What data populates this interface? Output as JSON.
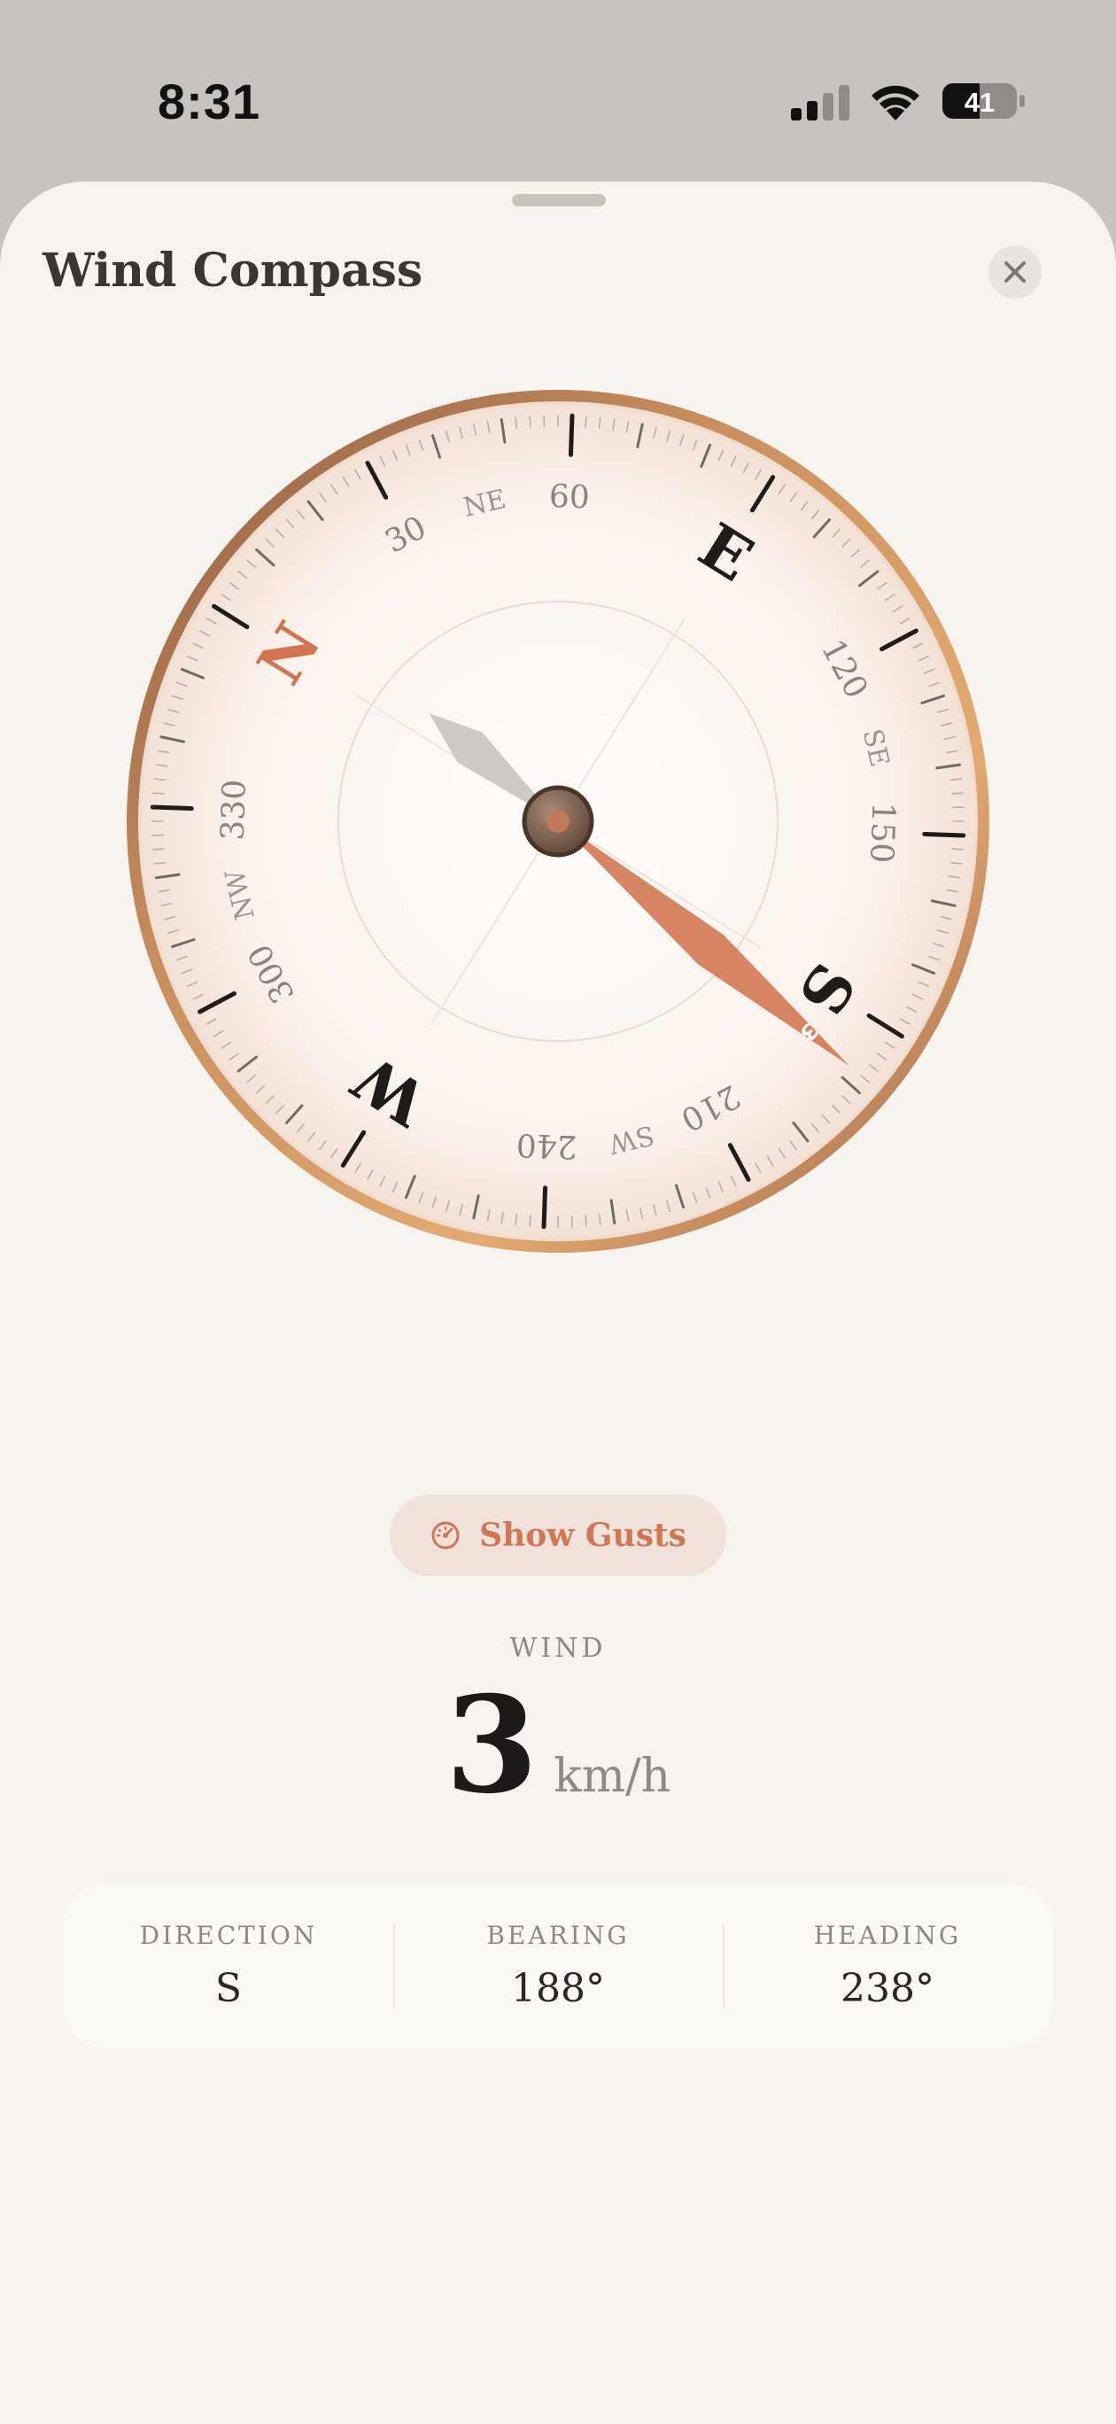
{
  "status": {
    "time": "8:31",
    "battery": "41"
  },
  "sheet": {
    "title": "Wind Compass"
  },
  "compass": {
    "heading_deg": 238,
    "wind_direction_deg": 188,
    "wind_speed_badge": "3",
    "cardinals": [
      {
        "label": "N",
        "deg": 0,
        "accent": true
      },
      {
        "label": "E",
        "deg": 90,
        "accent": false
      },
      {
        "label": "S",
        "deg": 180,
        "accent": false
      },
      {
        "label": "W",
        "deg": 270,
        "accent": false
      }
    ],
    "intercardinals": [
      {
        "label": "NE",
        "deg": 45
      },
      {
        "label": "SE",
        "deg": 135
      },
      {
        "label": "SW",
        "deg": 225
      },
      {
        "label": "NW",
        "deg": 315
      }
    ],
    "degree_labels": [
      "30",
      "60",
      "120",
      "150",
      "210",
      "240",
      "300",
      "330"
    ],
    "colors": {
      "accent": "#d2744f",
      "bezel_dark": "#8a5a40",
      "bezel_light": "#e0a672",
      "ink": "#1e1c1a"
    }
  },
  "gusts_button": {
    "label": "Show Gusts"
  },
  "wind": {
    "label": "WIND",
    "value": "3",
    "unit": "km/h"
  },
  "stats": [
    {
      "label": "DIRECTION",
      "value": "S"
    },
    {
      "label": "BEARING",
      "value": "188°"
    },
    {
      "label": "HEADING",
      "value": "238°"
    }
  ]
}
